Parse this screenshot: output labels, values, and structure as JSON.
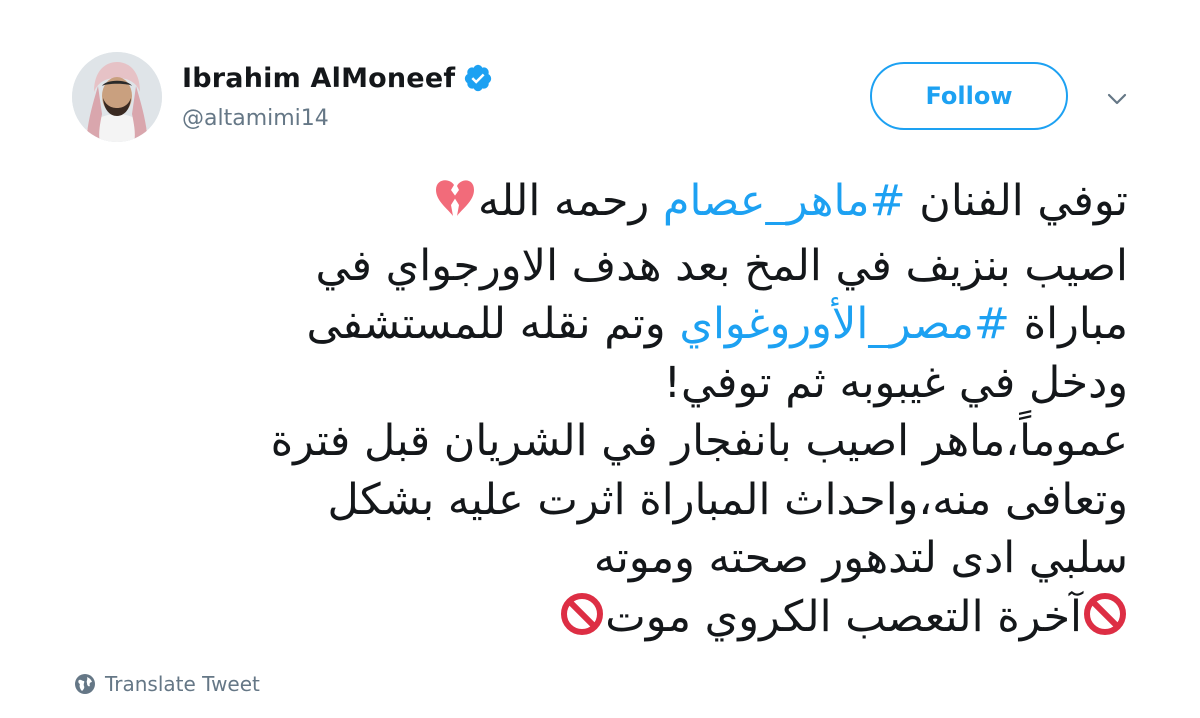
{
  "user": {
    "display_name": "Ibrahim AlMoneef",
    "handle": "@altamimi14",
    "verified": true
  },
  "actions": {
    "follow_label": "Follow",
    "menu_icon": "chevron-down-icon"
  },
  "tweet": {
    "lines": [
      {
        "segments": [
          {
            "text": "توفي الفنان ",
            "type": "text"
          },
          {
            "text": "#ماهر_عصام",
            "type": "hashtag"
          },
          {
            "text": " رحمه الله",
            "type": "text"
          },
          {
            "type": "emoji",
            "name": "broken-heart-icon"
          }
        ]
      },
      {
        "segments": [
          {
            "text": "اصيب بنزيف في المخ بعد هدف الاورجواي في",
            "type": "text"
          }
        ]
      },
      {
        "segments": [
          {
            "text": "مباراة ",
            "type": "text"
          },
          {
            "text": "#مصر_الأوروغواي",
            "type": "hashtag"
          },
          {
            "text": " وتم نقله للمستشفى",
            "type": "text"
          }
        ]
      },
      {
        "segments": [
          {
            "text": "ودخل في غيبوبه ثم توفي!",
            "type": "text"
          }
        ]
      },
      {
        "segments": [
          {
            "text": "عموماً،ماهر اصيب بانفجار في الشريان قبل فترة",
            "type": "text"
          }
        ]
      },
      {
        "segments": [
          {
            "text": "وتعافى منه،واحداث المباراة اثرت عليه بشكل",
            "type": "text"
          }
        ]
      },
      {
        "segments": [
          {
            "text": "سلبي ادى لتدهور صحته وموته",
            "type": "text"
          }
        ]
      },
      {
        "segments": [
          {
            "type": "emoji",
            "name": "prohibited-icon"
          },
          {
            "text": "آخرة التعصب الكروي موت",
            "type": "text"
          },
          {
            "type": "emoji",
            "name": "prohibited-icon"
          }
        ]
      }
    ]
  },
  "footer": {
    "translate_label": "Translate Tweet",
    "translate_icon": "globe-icon"
  },
  "colors": {
    "accent": "#1da1f2",
    "text": "#14171a",
    "secondary_text": "#657786",
    "broken_heart": "#f26b7a",
    "prohibited": "#dd2e44"
  }
}
